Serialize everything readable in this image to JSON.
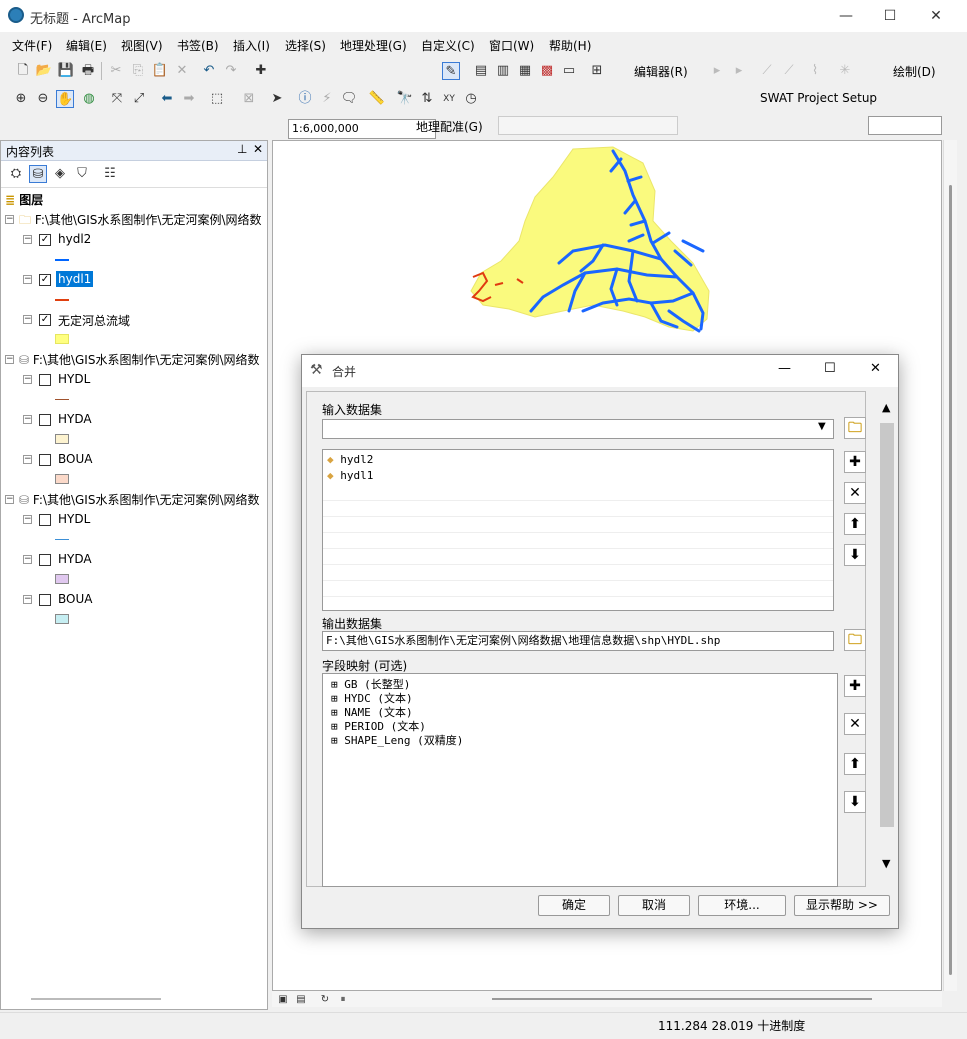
{
  "window": {
    "title": "无标题 - ArcMap"
  },
  "menu": [
    "文件(F)",
    "编辑(E)",
    "视图(V)",
    "书签(B)",
    "插入(I)",
    "选择(S)",
    "地理处理(G)",
    "自定义(C)",
    "窗口(W)",
    "帮助(H)"
  ],
  "toolbar": {
    "scale": "1:6,000,000",
    "editor": "编辑器(R)",
    "draw": "绘制(D)",
    "swat": "SWAT Project Setup",
    "georef": "地理配准(G)"
  },
  "toc": {
    "title": "内容列表",
    "layers_label": "图层",
    "groups": [
      {
        "path": "F:\\其他\\GIS水系图制作\\无定河案例\\网络数",
        "layers": [
          {
            "name": "hydl2",
            "checked": true,
            "color": "#0066ff",
            "sym": "line"
          },
          {
            "name": "hydl1",
            "checked": true,
            "color": "#e04010",
            "sym": "line",
            "selected": true
          },
          {
            "name": "无定河总流域",
            "checked": true,
            "color": "#ffff80",
            "sym": "box"
          }
        ]
      },
      {
        "path": "F:\\其他\\GIS水系图制作\\无定河案例\\网络数",
        "layers": [
          {
            "name": "HYDL",
            "checked": false,
            "color": "#a0522d",
            "sym": "line"
          },
          {
            "name": "HYDA",
            "checked": false,
            "color": "#fdf3d0",
            "sym": "box"
          },
          {
            "name": "BOUA",
            "checked": false,
            "color": "#fbd9c9",
            "sym": "box"
          }
        ]
      },
      {
        "path": "F:\\其他\\GIS水系图制作\\无定河案例\\网络数",
        "layers": [
          {
            "name": "HYDL",
            "checked": false,
            "color": "#3c8fd6",
            "sym": "line"
          },
          {
            "name": "HYDA",
            "checked": false,
            "color": "#e0c8ef",
            "sym": "box"
          },
          {
            "name": "BOUA",
            "checked": false,
            "color": "#c6eef2",
            "sym": "box"
          }
        ]
      }
    ]
  },
  "status": {
    "coords": "111.284  28.019 十进制度"
  },
  "dialog": {
    "title": "合并",
    "input_label": "输入数据集",
    "input_items": [
      "hydl2",
      "hydl1"
    ],
    "output_label": "输出数据集",
    "output_value": "F:\\其他\\GIS水系图制作\\无定河案例\\网络数据\\地理信息数据\\shp\\HYDL.shp",
    "fieldmap_label": "字段映射 (可选)",
    "fields": [
      "GB (长整型)",
      "HYDC (文本)",
      "NAME (文本)",
      "PERIOD (文本)",
      "SHAPE_Leng (双精度)"
    ],
    "buttons": {
      "ok": "确定",
      "cancel": "取消",
      "env": "环境...",
      "help": "显示帮助 >>"
    }
  }
}
